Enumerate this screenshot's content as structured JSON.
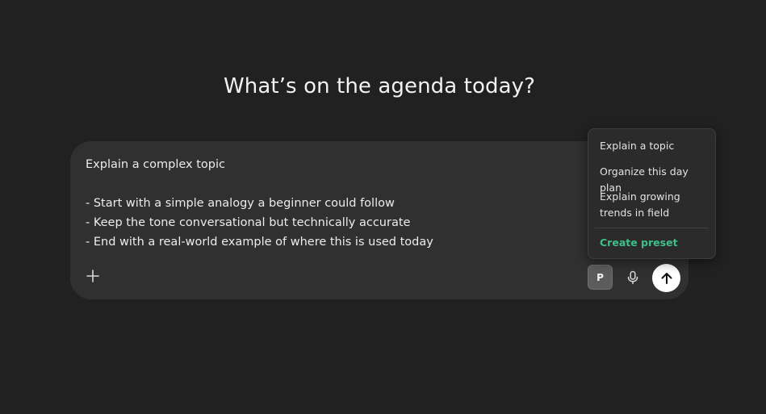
{
  "headline": "What’s on the agenda today?",
  "composer": {
    "text": "Explain a complex topic\n\n- Start with a simple analogy a beginner could follow\n- Keep the tone conversational but technically accurate\n- End with a real-world example of where this is used today",
    "preset_label": "P",
    "icons": {
      "add": "plus-icon",
      "mic": "microphone-icon",
      "send": "arrow-up-icon"
    }
  },
  "preset_menu": {
    "items": [
      "Explain a topic",
      "Organize this day plan",
      "Explain growing trends in field"
    ],
    "create_label": "Create preset",
    "create_color": "#3fbf8a"
  }
}
